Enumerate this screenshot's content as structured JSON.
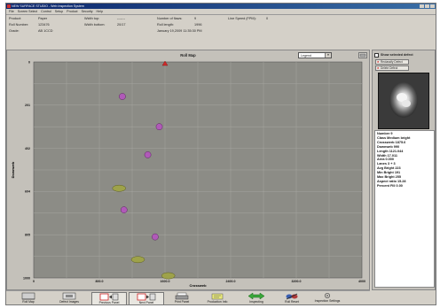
{
  "app": {
    "title": "NEW SURFACE STUDIO - Web Inspection System"
  },
  "menu": [
    "File",
    "Screen Select",
    "Control",
    "Setup",
    "Product",
    "Security",
    "Help"
  ],
  "info": {
    "product_label": "Product:",
    "product_value": "Paper",
    "roll_number_label": "Roll Number:",
    "roll_number_value": "123476",
    "grade_label": "Grade:",
    "grade_value": "AB 1CCD",
    "width_top_label": "Width top:",
    "width_top_value": "-------",
    "width_bottom_label": "Width bottom:",
    "width_bottom_value": "20/17",
    "defects_label": "Number of flaws:",
    "defects_value": "9",
    "roll_length_label": "Roll length:",
    "roll_length_value": "1996",
    "date": "January 19,2009 11:35:30 PM",
    "line_speed_label": "Line Speed (FPM):",
    "line_speed_value": "0"
  },
  "roll_map": {
    "title": "Roll Map",
    "legend_label": "Legend"
  },
  "right_panel": {
    "show_defect_label": "Show selected defect",
    "reclassify_label": "Reclassify Defect",
    "delete_label": "Delete Defect",
    "details": [
      "Number 9",
      "Class Medium bright",
      "Crosswerb 1875.6",
      "Downweb 990",
      "Length 1121.044",
      "Width 17.011",
      "Area 0.000",
      "Lanes 3 + 3",
      "Avg Bright 223",
      "Min Bright 191",
      "Max Bright 255",
      "Aspect ratio 15.28",
      "Percent Fill 0.00"
    ]
  },
  "toolbar": [
    {
      "label": "Roll Map",
      "icon": "roll-map-icon"
    },
    {
      "label": "Defect Images",
      "icon": "defect-images-icon"
    },
    {
      "label": "Previous Panel",
      "icon": "previous-panel-icon"
    },
    {
      "label": "Next Panel",
      "icon": "next-panel-icon"
    },
    {
      "label": "Print Panel",
      "icon": "printer-icon"
    },
    {
      "label": "Production Info",
      "icon": "production-info-icon"
    },
    {
      "label": "Inspecting",
      "icon": "inspecting-icon"
    },
    {
      "label": "Roll Reset",
      "icon": "roll-reset-icon"
    },
    {
      "label": "Inspection Settings",
      "icon": "inspection-settings-icon"
    }
  ],
  "chart_data": {
    "type": "scatter",
    "title": "Roll Map",
    "xlabel": "Crossweb",
    "ylabel": "Downweb",
    "xlim": [
      0,
      4000
    ],
    "ylim": [
      0,
      1000
    ],
    "y_inverted": true,
    "x_ticks": [
      "0",
      "800.0",
      "1600.0",
      "2400.0",
      "3200.0",
      "4000"
    ],
    "y_ticks": [
      "0",
      "201",
      "402",
      "604",
      "805",
      "1000"
    ],
    "grid": true,
    "colors": {
      "background": "#8c8c86",
      "gridline": "#a6a6a0",
      "circle": "#b05ab8",
      "ellipse": "#9ea24a",
      "triangle": "#d02a2a"
    },
    "points": [
      {
        "x": 1600,
        "y": 0,
        "shape": "triangle",
        "color": "#d02a2a"
      },
      {
        "x": 1080,
        "y": 160,
        "shape": "circle",
        "color": "#b05ab8"
      },
      {
        "x": 1530,
        "y": 300,
        "shape": "circle",
        "color": "#b05ab8"
      },
      {
        "x": 1390,
        "y": 430,
        "shape": "circle",
        "color": "#b05ab8"
      },
      {
        "x": 1040,
        "y": 585,
        "shape": "ellipse",
        "color": "#9ea24a"
      },
      {
        "x": 1100,
        "y": 685,
        "shape": "circle",
        "color": "#b05ab8"
      },
      {
        "x": 1480,
        "y": 810,
        "shape": "circle",
        "color": "#b05ab8"
      },
      {
        "x": 1270,
        "y": 915,
        "shape": "ellipse",
        "color": "#9ea24a"
      },
      {
        "x": 1640,
        "y": 990,
        "shape": "ellipse",
        "color": "#9ea24a"
      }
    ]
  }
}
